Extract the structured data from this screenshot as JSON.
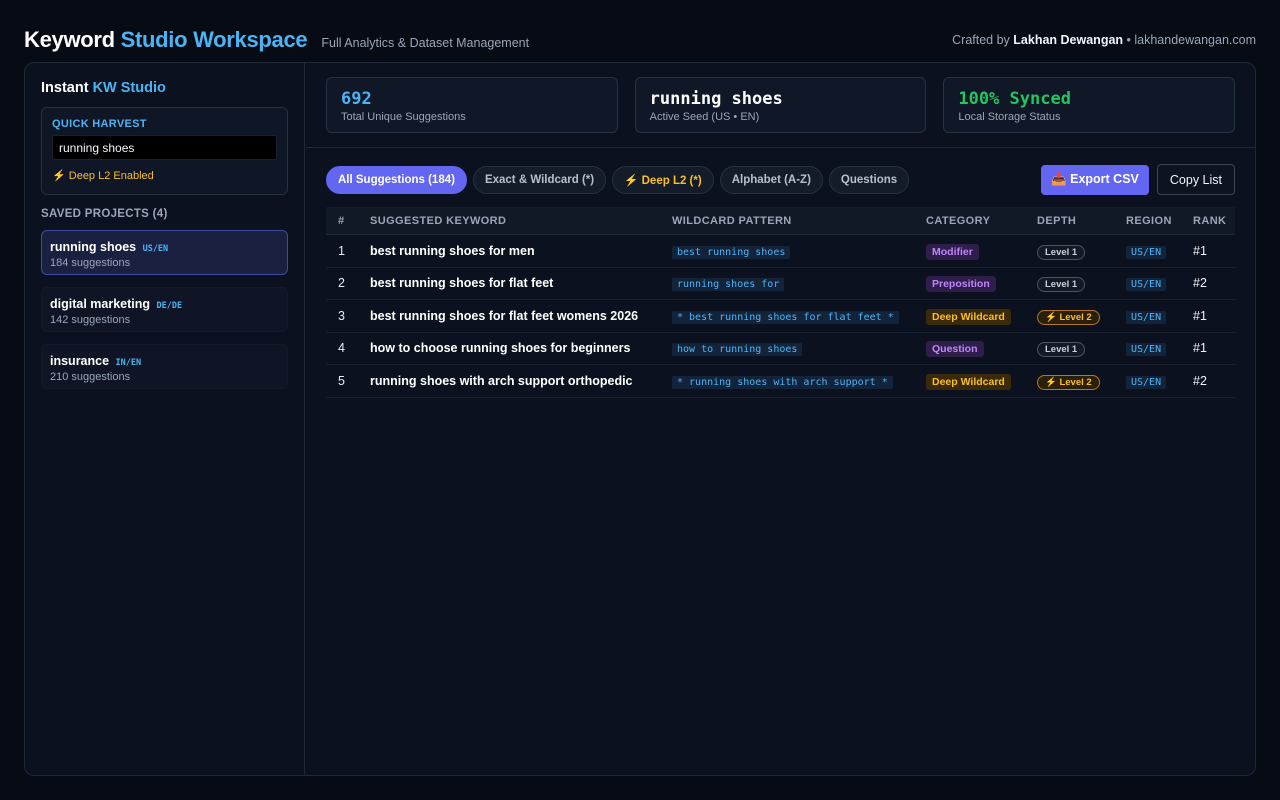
{
  "header": {
    "brand_main": "Keyword",
    "brand_accent": "Studio Workspace",
    "subtitle": "Full Analytics & Dataset Management",
    "credit_prefix": "Crafted by",
    "credit_name": "Lakhan Dewangan",
    "credit_suffix": "• lakhandewangan.com"
  },
  "sidebar": {
    "title_main": "Instant",
    "title_accent": "KW Studio",
    "harvest_label": "QUICK HARVEST",
    "harvest_value": "running shoes",
    "deep_flag": "⚡ Deep L2 Enabled",
    "saved_title": "SAVED PROJECTS (4)",
    "projects": [
      {
        "name": "running shoes",
        "region": "US/EN",
        "count": "184 suggestions"
      },
      {
        "name": "digital marketing",
        "region": "DE/DE",
        "count": "142 suggestions"
      },
      {
        "name": "insurance",
        "region": "IN/EN",
        "count": "210 suggestions"
      }
    ]
  },
  "stats": [
    {
      "value": "692",
      "label": "Total Unique Suggestions"
    },
    {
      "value": "running shoes",
      "label": "Active Seed (US • EN)"
    },
    {
      "value": "100% Synced",
      "label": "Local Storage Status"
    }
  ],
  "filters": {
    "all": "All Suggestions (184)",
    "exact": "Exact & Wildcard (*)",
    "deep": "⚡ Deep L2 (*)",
    "alpha": "Alphabet (A-Z)",
    "questions": "Questions"
  },
  "actions": {
    "export": "📥 Export CSV",
    "copy": "Copy List"
  },
  "table": {
    "headers": [
      "#",
      "SUGGESTED KEYWORD",
      "WILDCARD PATTERN",
      "CATEGORY",
      "DEPTH",
      "REGION",
      "RANK"
    ],
    "rows": [
      {
        "num": "1",
        "keyword": "best running shoes for men",
        "pattern": "best running shoes",
        "category": "Modifier",
        "depth": "Level 1",
        "region": "US/EN",
        "rank": "#1"
      },
      {
        "num": "2",
        "keyword": "best running shoes for flat feet",
        "pattern": "running shoes for",
        "category": "Preposition",
        "depth": "Level 1",
        "region": "US/EN",
        "rank": "#2"
      },
      {
        "num": "3",
        "keyword": "best running shoes for flat feet womens 2026",
        "pattern": "* best running shoes for flat feet *",
        "category": "Deep Wildcard",
        "depth": "⚡ Level 2",
        "region": "US/EN",
        "rank": "#1"
      },
      {
        "num": "4",
        "keyword": "how to choose running shoes for beginners",
        "pattern": "how to running shoes",
        "category": "Question",
        "depth": "Level 1",
        "region": "US/EN",
        "rank": "#1"
      },
      {
        "num": "5",
        "keyword": "running shoes with arch support orthopedic",
        "pattern": "* running shoes with arch support *",
        "category": "Deep Wildcard",
        "depth": "⚡ Level 2",
        "region": "US/EN",
        "rank": "#2"
      }
    ]
  }
}
